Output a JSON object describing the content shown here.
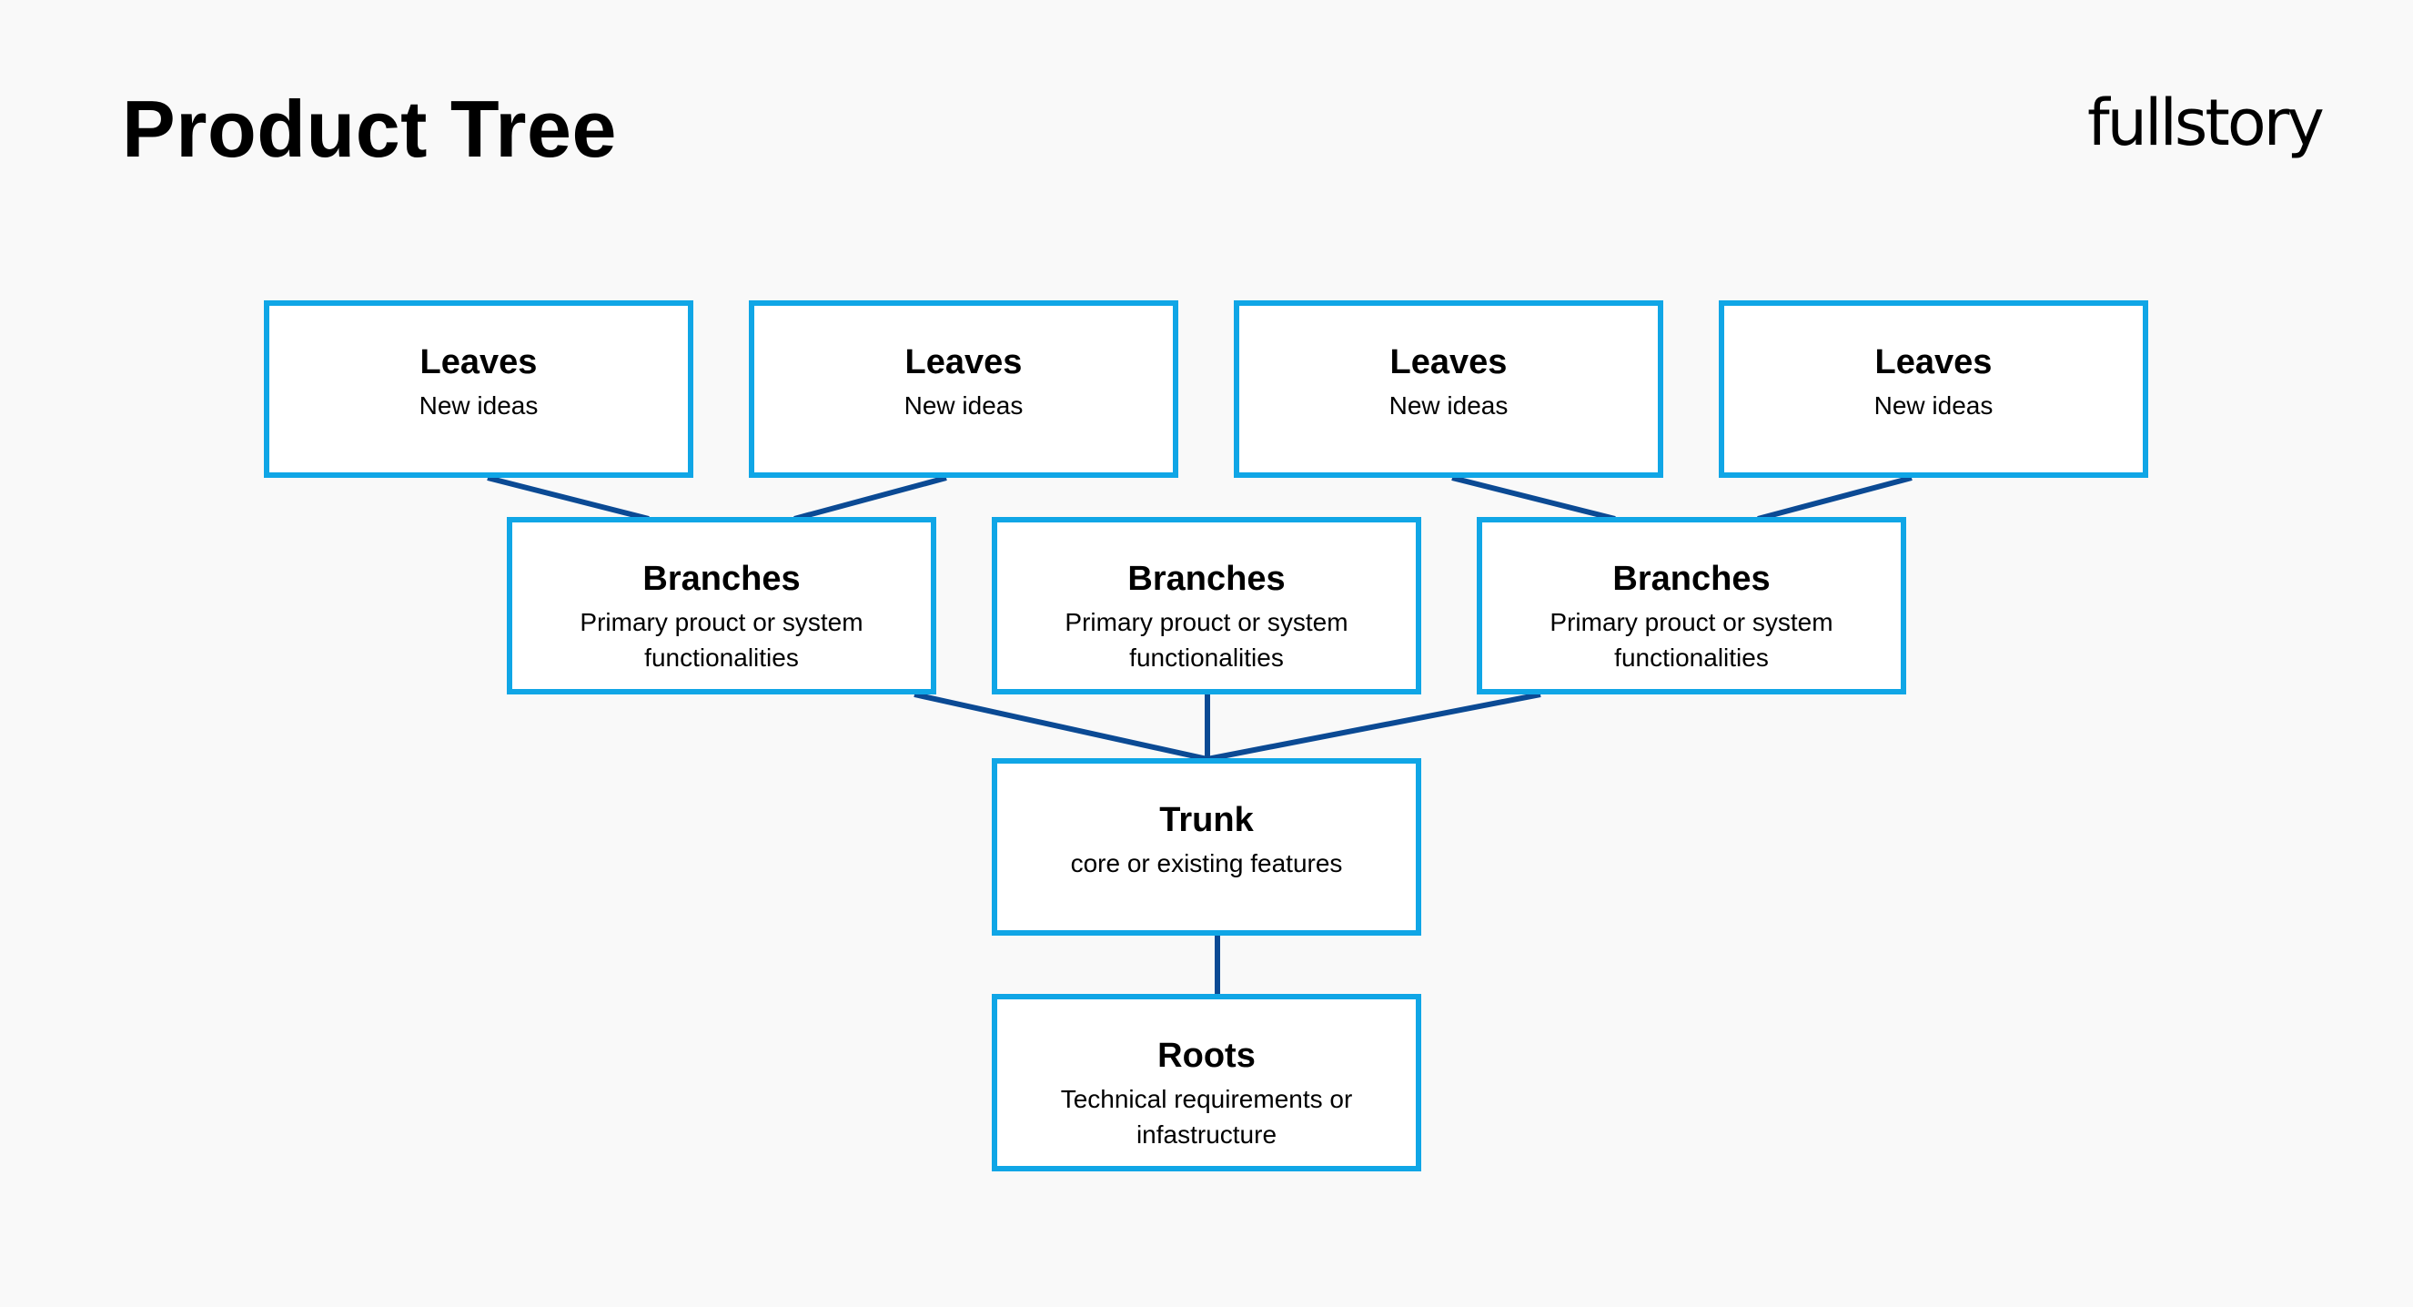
{
  "header": {
    "title": "Product Tree",
    "logo_text": "fullstory"
  },
  "colors": {
    "background": "#f9f9f9",
    "box_border": "#10a6e6",
    "connector": "#0b4a94",
    "text": "#000000"
  },
  "tree": {
    "leaves": [
      {
        "name": "Leaves",
        "desc": "New ideas"
      },
      {
        "name": "Leaves",
        "desc": "New ideas"
      },
      {
        "name": "Leaves",
        "desc": "New ideas"
      },
      {
        "name": "Leaves",
        "desc": "New ideas"
      }
    ],
    "branches": [
      {
        "name": "Branches",
        "desc": "Primary prouct or system functionalities"
      },
      {
        "name": "Branches",
        "desc": "Primary prouct or system functionalities"
      },
      {
        "name": "Branches",
        "desc": "Primary prouct or system functionalities"
      }
    ],
    "trunk": {
      "name": "Trunk",
      "desc": "core or existing features"
    },
    "roots": {
      "name": "Roots",
      "desc": "Technical requirements or infastructure"
    },
    "connections": [
      {
        "from": "leaves.0",
        "to": "branches.0"
      },
      {
        "from": "leaves.1",
        "to": "branches.0"
      },
      {
        "from": "leaves.2",
        "to": "branches.2"
      },
      {
        "from": "leaves.3",
        "to": "branches.2"
      },
      {
        "from": "branches.0",
        "to": "trunk"
      },
      {
        "from": "branches.1",
        "to": "trunk"
      },
      {
        "from": "branches.2",
        "to": "trunk"
      },
      {
        "from": "trunk",
        "to": "roots"
      }
    ]
  }
}
